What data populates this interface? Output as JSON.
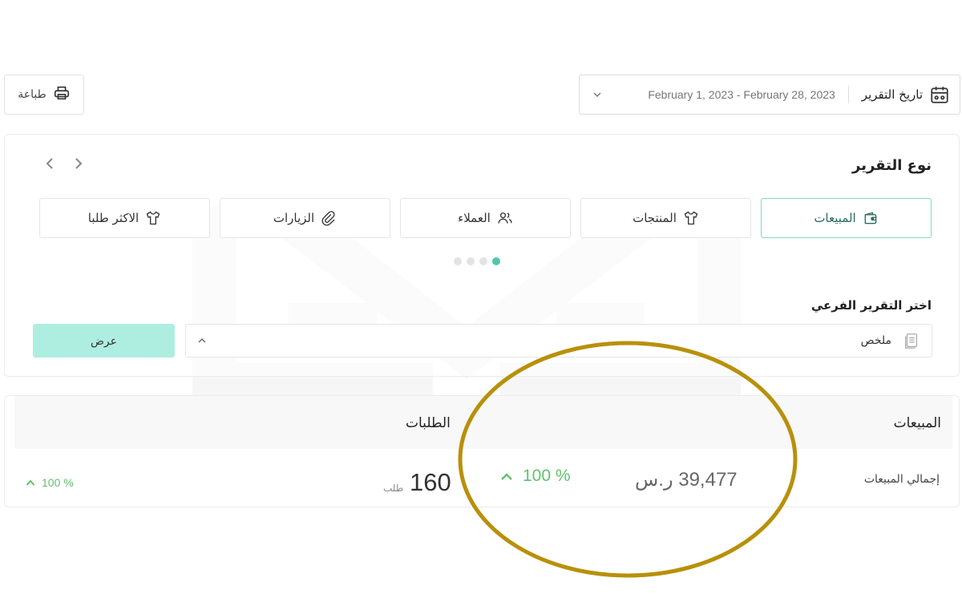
{
  "toolbar": {
    "print_label": "طباعة",
    "date_label": "تاريخ التقرير",
    "date_range": "February 1, 2023 - February 28, 2023"
  },
  "report_type": {
    "title": "نوع التقرير",
    "tabs": [
      {
        "label": "المبيعات",
        "icon": "wallet-icon",
        "active": true
      },
      {
        "label": "المنتجات",
        "icon": "shirt-icon",
        "active": false
      },
      {
        "label": "العملاء",
        "icon": "users-icon",
        "active": false
      },
      {
        "label": "الزيارات",
        "icon": "link-icon",
        "active": false
      },
      {
        "label": "الاكثر طلبا",
        "icon": "shirt-icon",
        "active": false
      }
    ],
    "carousel_pages": 4,
    "carousel_active": 1
  },
  "sub_report": {
    "label": "اختر التقرير الفرعي",
    "selected": "ملخص",
    "show_button": "عرض"
  },
  "summary": {
    "title": "المبيعات",
    "orders_title": "الطلبات",
    "total_sales_label": "إجمالي المبيعات",
    "total_sales_value": "39,477 ر.س",
    "total_sales_change": "100 %",
    "orders_value": "160",
    "orders_unit": "طلب",
    "orders_change": "100 %"
  },
  "colors": {
    "accent": "#4fc7b0",
    "active_tab_border": "#7fd8c8",
    "show_button_bg": "#aeeee0",
    "positive": "#62c16b",
    "highlight_ellipse": "#b8900a"
  }
}
